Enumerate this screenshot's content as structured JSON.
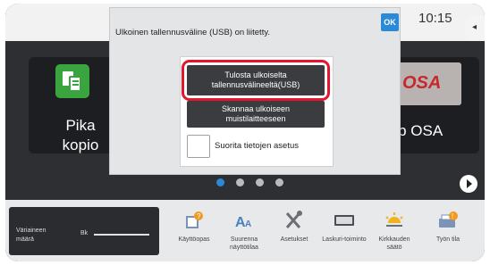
{
  "status": {
    "time": "10:15",
    "side_tab": "◂"
  },
  "home": {
    "tile_left": {
      "label_line1": "Pika",
      "label_line2": "kopio"
    },
    "tile_right": {
      "label": "arp OSA",
      "logo_text": "OSA"
    }
  },
  "pager": {
    "dots": 4,
    "active": 0
  },
  "bottom": {
    "toner_label": "Väriaineen määrä",
    "toner_color": "Bk",
    "shortcuts": [
      {
        "label": "Käyttöopas",
        "icon": "book-help-icon"
      },
      {
        "label": "Suurenna näyttötilaa",
        "icon": "text-enlarge-icon"
      },
      {
        "label": "Asetukset",
        "icon": "tools-icon"
      },
      {
        "label": "Laskuri-toiminto",
        "icon": "counter-icon"
      },
      {
        "label": "Kirkkauden säätö",
        "icon": "brightness-icon"
      },
      {
        "label": "Työn tila",
        "icon": "job-status-icon"
      }
    ]
  },
  "dialog": {
    "message": "Ulkoinen tallennusväline (USB) on liitetty.",
    "ok_label": "OK",
    "print_button": {
      "line1": "Tulosta ulkoiselta",
      "line2": "tallennusvälineeltä(USB)"
    },
    "scan_button": {
      "line1": "Skannaa ulkoiseen",
      "line2": "muistilaitteeseen"
    },
    "settings_checkbox_label": "Suorita tietojen asetus"
  },
  "colors": {
    "accent": "#2b8ad8",
    "highlight": "#e4162c",
    "tile_green": "#3aa43f"
  }
}
